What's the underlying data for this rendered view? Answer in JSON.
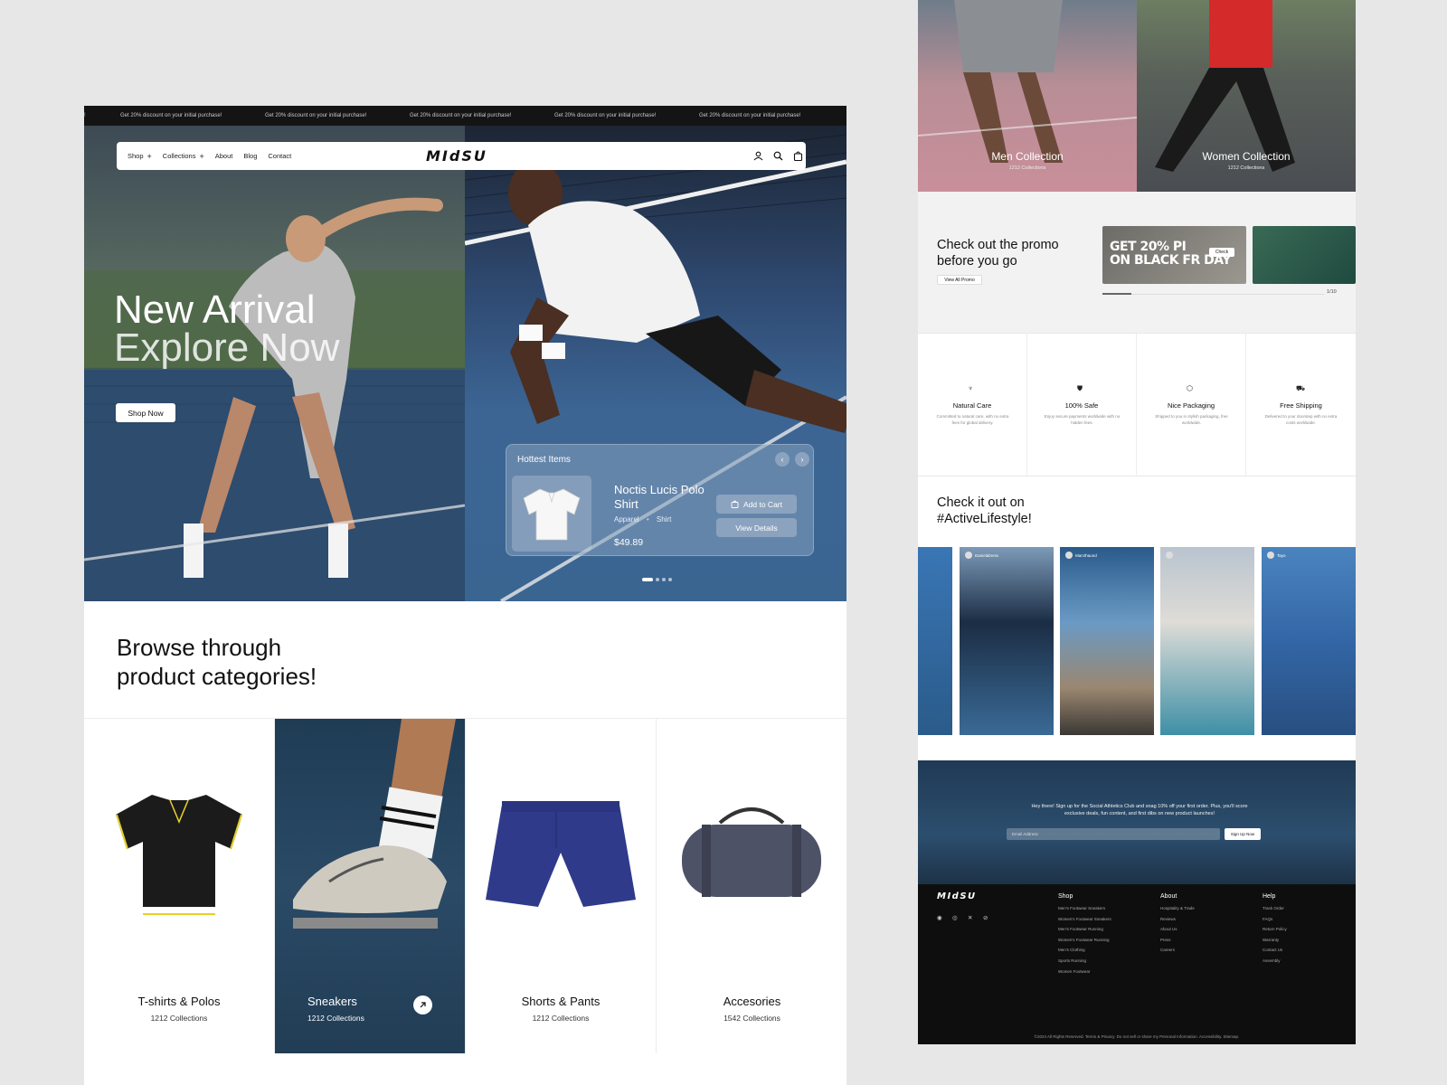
{
  "ticker": {
    "message": "Get 20% discount on your initial purchase!",
    "partial": "!"
  },
  "nav": {
    "items": [
      {
        "label": "Shop",
        "has_plus": true
      },
      {
        "label": "Collections",
        "has_plus": true
      },
      {
        "label": "About",
        "has_plus": false
      },
      {
        "label": "Blog",
        "has_plus": false
      },
      {
        "label": "Contact",
        "has_plus": false
      }
    ],
    "plus_glyph": "+",
    "logo": "MIdSU",
    "icons": [
      "user-icon",
      "search-icon",
      "cart-icon"
    ]
  },
  "hero": {
    "title_line1": "New Arrival",
    "title_line2": "Explore Now",
    "cta": "Shop Now"
  },
  "hottest": {
    "title": "Hottest Items",
    "prev": "‹",
    "next": "›",
    "product": {
      "name": "Noctis Lucis Polo Shirt",
      "category": "Apparel",
      "type": "Shirt",
      "separator": "•",
      "price": "$49.89"
    },
    "add_to_cart": "Add to Cart",
    "view_details": "View Details",
    "slides": 4,
    "active_slide": 1
  },
  "browse": {
    "title_line1": "Browse through",
    "title_line2": "product categories!"
  },
  "categories": [
    {
      "name": "T-shirts & Polos",
      "count": "1212 Collections"
    },
    {
      "name": "Sneakers",
      "count": "1212 Collections",
      "active": true
    },
    {
      "name": "Shorts & Pants",
      "count": "1212 Collections"
    },
    {
      "name": "Accesories",
      "count": "1542 Collections"
    }
  ],
  "collections": [
    {
      "name": "Men Collection",
      "count": "1212 Collections"
    },
    {
      "name": "Women Collection",
      "count": "1212 Collections"
    }
  ],
  "promo": {
    "title_line1": "Check out the promo",
    "title_line2": "before you go",
    "view_all": "View All Promo",
    "banner_line1": "GET 20% PI",
    "banner_line2": "ON BLACK FR DAY",
    "check": "Check",
    "page": "1/10"
  },
  "features": [
    {
      "icon": "leaf-icon",
      "glyph": "♆",
      "title": "Natural Care",
      "desc": "Committed to natural care, with no extra fees for global delivery."
    },
    {
      "icon": "shield-icon",
      "glyph": "⛊",
      "title": "100% Safe",
      "desc": "Enjoy secure payments worldwide with no hidden fees."
    },
    {
      "icon": "box-icon",
      "glyph": "⬡",
      "title": "Nice Packaging",
      "desc": "Shipped to you in stylish packaging, free worldwide."
    },
    {
      "icon": "truck-icon",
      "glyph": "⛟",
      "title": "Free Shipping",
      "desc": "Delivered to your doorstep with no extra costs worldwide."
    }
  ],
  "social": {
    "title_line1": "Check it out on",
    "title_line2": "#ActiveLifestyle!",
    "posts": [
      {
        "user": ""
      },
      {
        "user": "Danielabrera"
      },
      {
        "user": "Marcthaund"
      },
      {
        "user": ""
      },
      {
        "user": "Tayo"
      }
    ]
  },
  "newsletter": {
    "text": "Hey there! Sign up for the Social Athletics Club and snag 10% off your first order. Plus, you'll score exclusive deals, fun content, and first dibs on new product launches!",
    "placeholder": "Email Address",
    "button": "Sign Up Now"
  },
  "footer": {
    "logo": "MIdSU",
    "social_icons": [
      "instagram-icon",
      "camera-icon",
      "x-icon",
      "link-icon"
    ],
    "social_glyphs": [
      "◉",
      "◎",
      "✕",
      "⊘"
    ],
    "columns": [
      {
        "title": "Shop",
        "links": [
          "Men's Footwear Sneakers",
          "Women's Footwear Sneakers",
          "Men's Footwear Running",
          "Women's Footwear Running",
          "Men's Clothing",
          "Sports Running",
          "Women Footwear"
        ]
      },
      {
        "title": "About",
        "links": [
          "Hospitality & Trade",
          "Reviews",
          "About Us",
          "Press",
          "Careers"
        ]
      },
      {
        "title": "Help",
        "links": [
          "Track Order",
          "FAQs",
          "Return Policy",
          "Warranty",
          "Contact Us",
          "Assembly"
        ]
      }
    ],
    "copyright": "©2024 All Rights Reserved. Terms & Privacy. Do not sell or share my Personal Information. Accessibility. Sitemap."
  },
  "colors": {
    "bg": "#e7e7e7",
    "ticker_bg": "#141414",
    "footer_bg": "#0e0e0e",
    "court_blue": "#3c6594",
    "polo_accent": "#e7d323"
  }
}
